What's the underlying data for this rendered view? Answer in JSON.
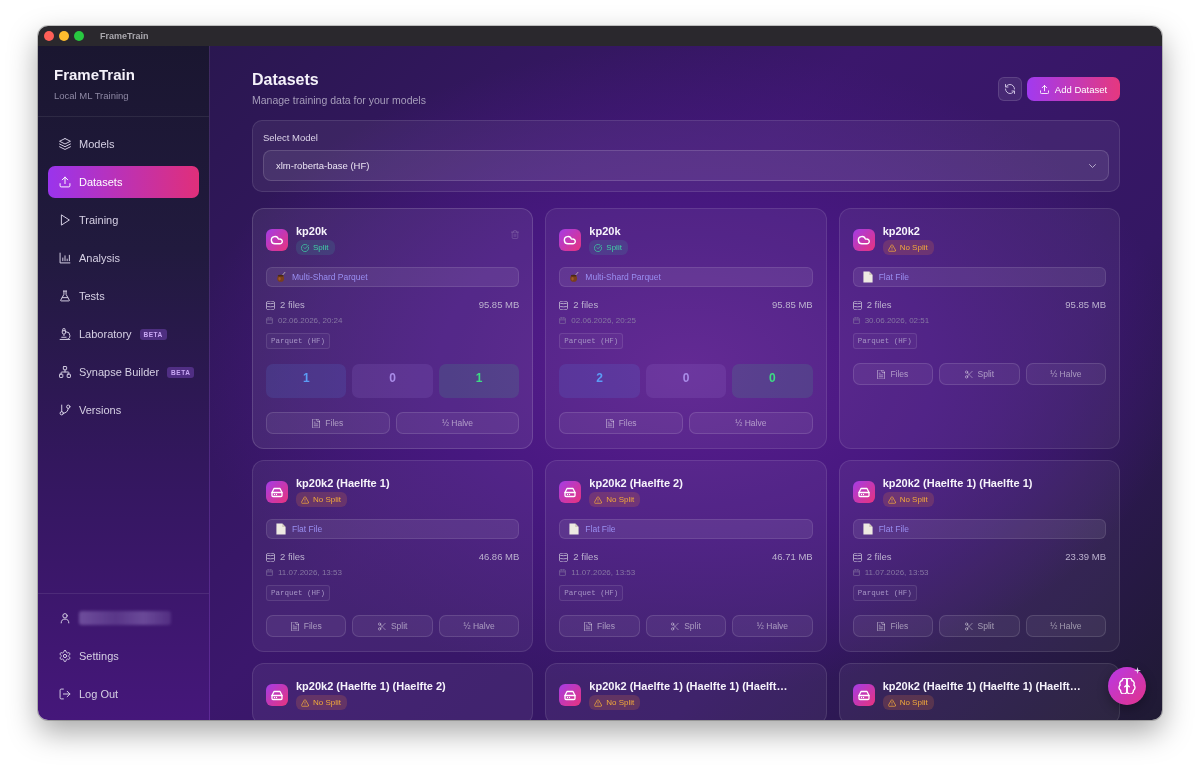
{
  "window": {
    "title": "FrameTrain"
  },
  "sidebar": {
    "brand": "FrameTrain",
    "tagline": "Local ML Training",
    "items": [
      {
        "label": "Models",
        "selected": false
      },
      {
        "label": "Datasets",
        "selected": true
      },
      {
        "label": "Training",
        "selected": false
      },
      {
        "label": "Analysis",
        "selected": false
      },
      {
        "label": "Tests",
        "selected": false
      },
      {
        "label": "Laboratory",
        "badge": "BETA",
        "selected": false
      },
      {
        "label": "Synapse Builder",
        "badge": "BETA",
        "selected": false
      },
      {
        "label": "Versions",
        "selected": false
      }
    ],
    "footer_items": [
      {
        "label": "Settings"
      },
      {
        "label": "Log Out"
      }
    ]
  },
  "header": {
    "title": "Datasets",
    "subtitle": "Manage training data for your models",
    "add_button": "Add Dataset"
  },
  "model_select": {
    "label": "Select Model",
    "value": "xlm-roberta-base (HF)"
  },
  "datasets": [
    {
      "name": "kp20k",
      "kind": "cloud",
      "hovered": true,
      "status": {
        "label": "Split",
        "kind": "ok"
      },
      "format": {
        "label": "Multi-Shard Parquet",
        "kind": "sharded"
      },
      "files": "2 files",
      "size": "95.85 MB",
      "date": "02.06.2026, 20:24",
      "tag": "Parquet (HF)",
      "stats": [
        {
          "value": "1",
          "color": "#5b9cf5"
        },
        {
          "value": "0",
          "color": "#a98ce8"
        },
        {
          "value": "1",
          "color": "#3ddc84"
        }
      ],
      "actions": [
        {
          "label": "Files",
          "kind": "files"
        },
        {
          "label": "½ Halve",
          "kind": "halve"
        }
      ]
    },
    {
      "name": "kp20k",
      "kind": "cloud",
      "hovered": false,
      "status": {
        "label": "Split",
        "kind": "ok"
      },
      "format": {
        "label": "Multi-Shard Parquet",
        "kind": "sharded"
      },
      "files": "2 files",
      "size": "95.85 MB",
      "date": "02.06.2026, 20:25",
      "tag": "Parquet (HF)",
      "stats": [
        {
          "value": "2",
          "color": "#5b9cf5"
        },
        {
          "value": "0",
          "color": "#a98ce8"
        },
        {
          "value": "0",
          "color": "#3ddc84"
        }
      ],
      "actions": [
        {
          "label": "Files",
          "kind": "files"
        },
        {
          "label": "½ Halve",
          "kind": "halve"
        }
      ]
    },
    {
      "name": "kp20k2",
      "kind": "cloud",
      "hovered": false,
      "status": {
        "label": "No Split",
        "kind": "warn"
      },
      "format": {
        "label": "Flat File",
        "kind": "flat"
      },
      "files": "2 files",
      "size": "95.85 MB",
      "date": "30.06.2026, 02:51",
      "tag": "Parquet (HF)",
      "actions": [
        {
          "label": "Files",
          "kind": "files"
        },
        {
          "label": "Split",
          "kind": "split"
        },
        {
          "label": "½ Halve",
          "kind": "halve"
        }
      ]
    },
    {
      "name": "kp20k2 (Haelfte 1)",
      "kind": "drive",
      "hovered": false,
      "status": {
        "label": "No Split",
        "kind": "warn"
      },
      "format": {
        "label": "Flat File",
        "kind": "flat"
      },
      "files": "2 files",
      "size": "46.86 MB",
      "date": "11.07.2026, 13:53",
      "tag": "Parquet (HF)",
      "actions": [
        {
          "label": "Files",
          "kind": "files"
        },
        {
          "label": "Split",
          "kind": "split"
        },
        {
          "label": "½ Halve",
          "kind": "halve"
        }
      ]
    },
    {
      "name": "kp20k2 (Haelfte 2)",
      "kind": "drive",
      "hovered": false,
      "status": {
        "label": "No Split",
        "kind": "warn"
      },
      "format": {
        "label": "Flat File",
        "kind": "flat"
      },
      "files": "2 files",
      "size": "46.71 MB",
      "date": "11.07.2026, 13:53",
      "tag": "Parquet (HF)",
      "actions": [
        {
          "label": "Files",
          "kind": "files"
        },
        {
          "label": "Split",
          "kind": "split"
        },
        {
          "label": "½ Halve",
          "kind": "halve"
        }
      ]
    },
    {
      "name": "kp20k2 (Haelfte 1) (Haelfte 1)",
      "kind": "drive",
      "hovered": false,
      "status": {
        "label": "No Split",
        "kind": "warn"
      },
      "format": {
        "label": "Flat File",
        "kind": "flat"
      },
      "files": "2 files",
      "size": "23.39 MB",
      "date": "11.07.2026, 13:53",
      "tag": "Parquet (HF)",
      "actions": [
        {
          "label": "Files",
          "kind": "files"
        },
        {
          "label": "Split",
          "kind": "split"
        },
        {
          "label": "½ Halve",
          "kind": "halve"
        }
      ]
    },
    {
      "name": "kp20k2 (Haelfte 1) (Haelfte 2)",
      "kind": "drive",
      "hovered": false,
      "status": {
        "label": "No Split",
        "kind": "warn"
      }
    },
    {
      "name": "kp20k2 (Haelfte 1) (Haelfte 1) (Haelft…",
      "kind": "drive",
      "hovered": false,
      "status": {
        "label": "No Split",
        "kind": "warn"
      }
    },
    {
      "name": "kp20k2 (Haelfte 1) (Haelfte 1) (Haelft…",
      "kind": "drive",
      "hovered": false,
      "status": {
        "label": "No Split",
        "kind": "warn"
      }
    }
  ]
}
